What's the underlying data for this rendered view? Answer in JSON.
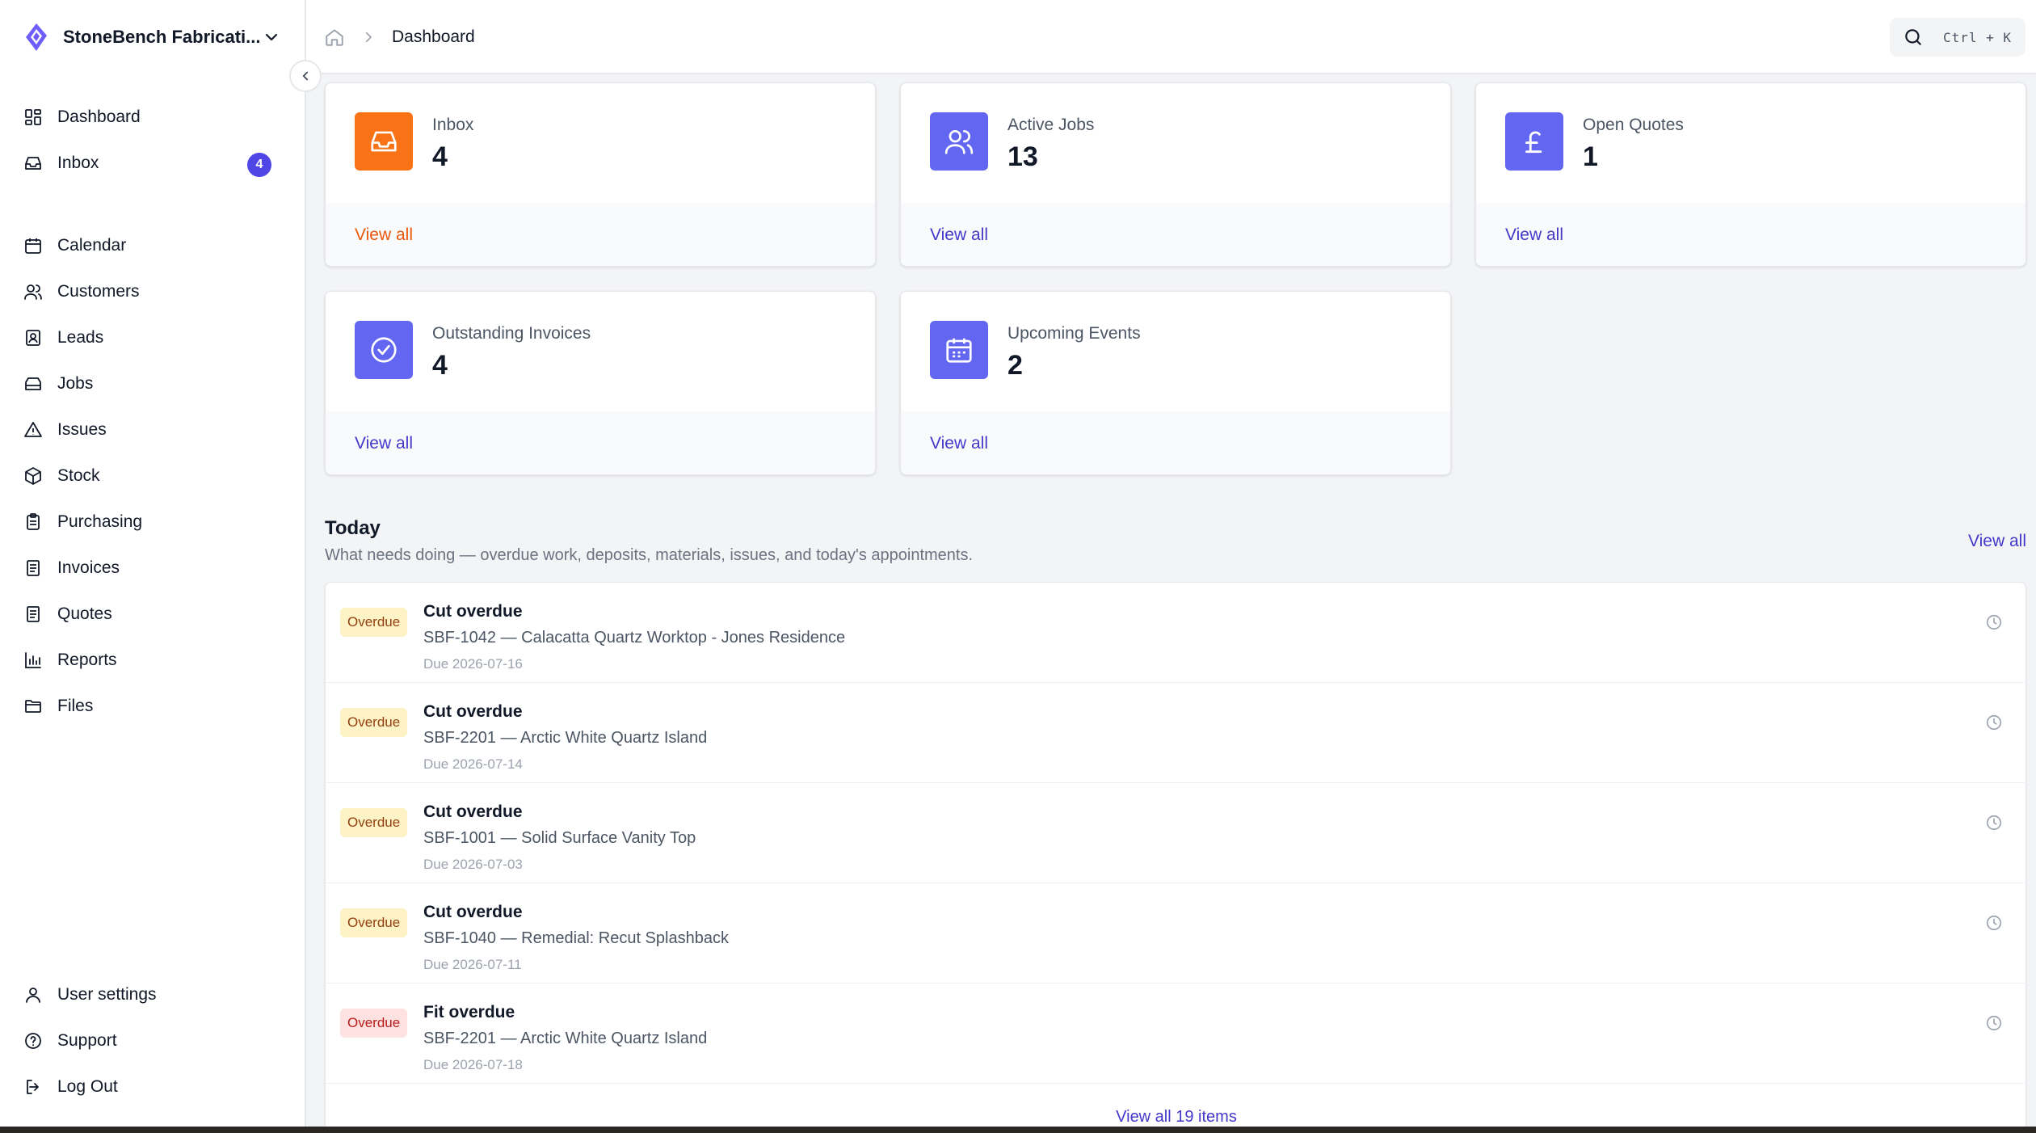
{
  "brand": {
    "name": "StoneBench Fabricati...",
    "logo_icon": "brand-logo",
    "accent": "#4f46e5"
  },
  "sidebar": {
    "items_primary": [
      {
        "label": "Dashboard",
        "icon": "dashboard-icon"
      },
      {
        "label": "Inbox",
        "icon": "inbox-icon",
        "badge": "4"
      }
    ],
    "items_main": [
      {
        "label": "Calendar",
        "icon": "calendar-icon"
      },
      {
        "label": "Customers",
        "icon": "users-icon"
      },
      {
        "label": "Leads",
        "icon": "contact-icon"
      },
      {
        "label": "Jobs",
        "icon": "stack-icon"
      },
      {
        "label": "Issues",
        "icon": "warning-icon"
      },
      {
        "label": "Stock",
        "icon": "box-icon"
      },
      {
        "label": "Purchasing",
        "icon": "clipboard-icon"
      },
      {
        "label": "Invoices",
        "icon": "document-icon"
      },
      {
        "label": "Quotes",
        "icon": "document-icon"
      },
      {
        "label": "Reports",
        "icon": "bar-chart-icon"
      },
      {
        "label": "Files",
        "icon": "folder-icon"
      }
    ],
    "items_bottom": [
      {
        "label": "User settings",
        "icon": "user-icon"
      },
      {
        "label": "Support",
        "icon": "help-icon"
      },
      {
        "label": "Log Out",
        "icon": "logout-icon"
      }
    ]
  },
  "topbar": {
    "breadcrumb_current": "Dashboard",
    "search_shortcut": "Ctrl + K"
  },
  "cards": [
    {
      "label": "Inbox",
      "value": "4",
      "link": "View all",
      "icon": "inbox-icon",
      "color": "#f97316",
      "link_color": "#ea580c"
    },
    {
      "label": "Active Jobs",
      "value": "13",
      "link": "View all",
      "icon": "users-icon",
      "color": "#6366f1",
      "link_color": "#4338ca"
    },
    {
      "label": "Open Quotes",
      "value": "1",
      "link": "View all",
      "icon": "pound-icon",
      "color": "#6366f1",
      "link_color": "#4338ca"
    },
    {
      "label": "Outstanding Invoices",
      "value": "4",
      "link": "View all",
      "icon": "check-circle-icon",
      "color": "#6366f1",
      "link_color": "#4338ca"
    },
    {
      "label": "Upcoming Events",
      "value": "2",
      "link": "View all",
      "icon": "calendar-icon",
      "color": "#6366f1",
      "link_color": "#4338ca"
    }
  ],
  "today": {
    "title": "Today",
    "subtitle": "What needs doing — overdue work, deposits, materials, issues, and today's appointments.",
    "view_all": "View all",
    "items": [
      {
        "tag": "Overdue",
        "tag_style": "amber",
        "title": "Cut overdue",
        "desc": "SBF-1042 — Calacatta Quartz Worktop - Jones Residence",
        "due": "Due 2026-07-16"
      },
      {
        "tag": "Overdue",
        "tag_style": "amber",
        "title": "Cut overdue",
        "desc": "SBF-2201 — Arctic White Quartz Island",
        "due": "Due 2026-07-14"
      },
      {
        "tag": "Overdue",
        "tag_style": "amber",
        "title": "Cut overdue",
        "desc": "SBF-1001 — Solid Surface Vanity Top",
        "due": "Due 2026-07-03"
      },
      {
        "tag": "Overdue",
        "tag_style": "amber",
        "title": "Cut overdue",
        "desc": "SBF-1040 — Remedial: Recut Splashback",
        "due": "Due 2026-07-11"
      },
      {
        "tag": "Overdue",
        "tag_style": "red",
        "title": "Fit overdue",
        "desc": "SBF-2201 — Arctic White Quartz Island",
        "due": "Due 2026-07-18"
      }
    ],
    "more_link": "View all 19 items"
  }
}
